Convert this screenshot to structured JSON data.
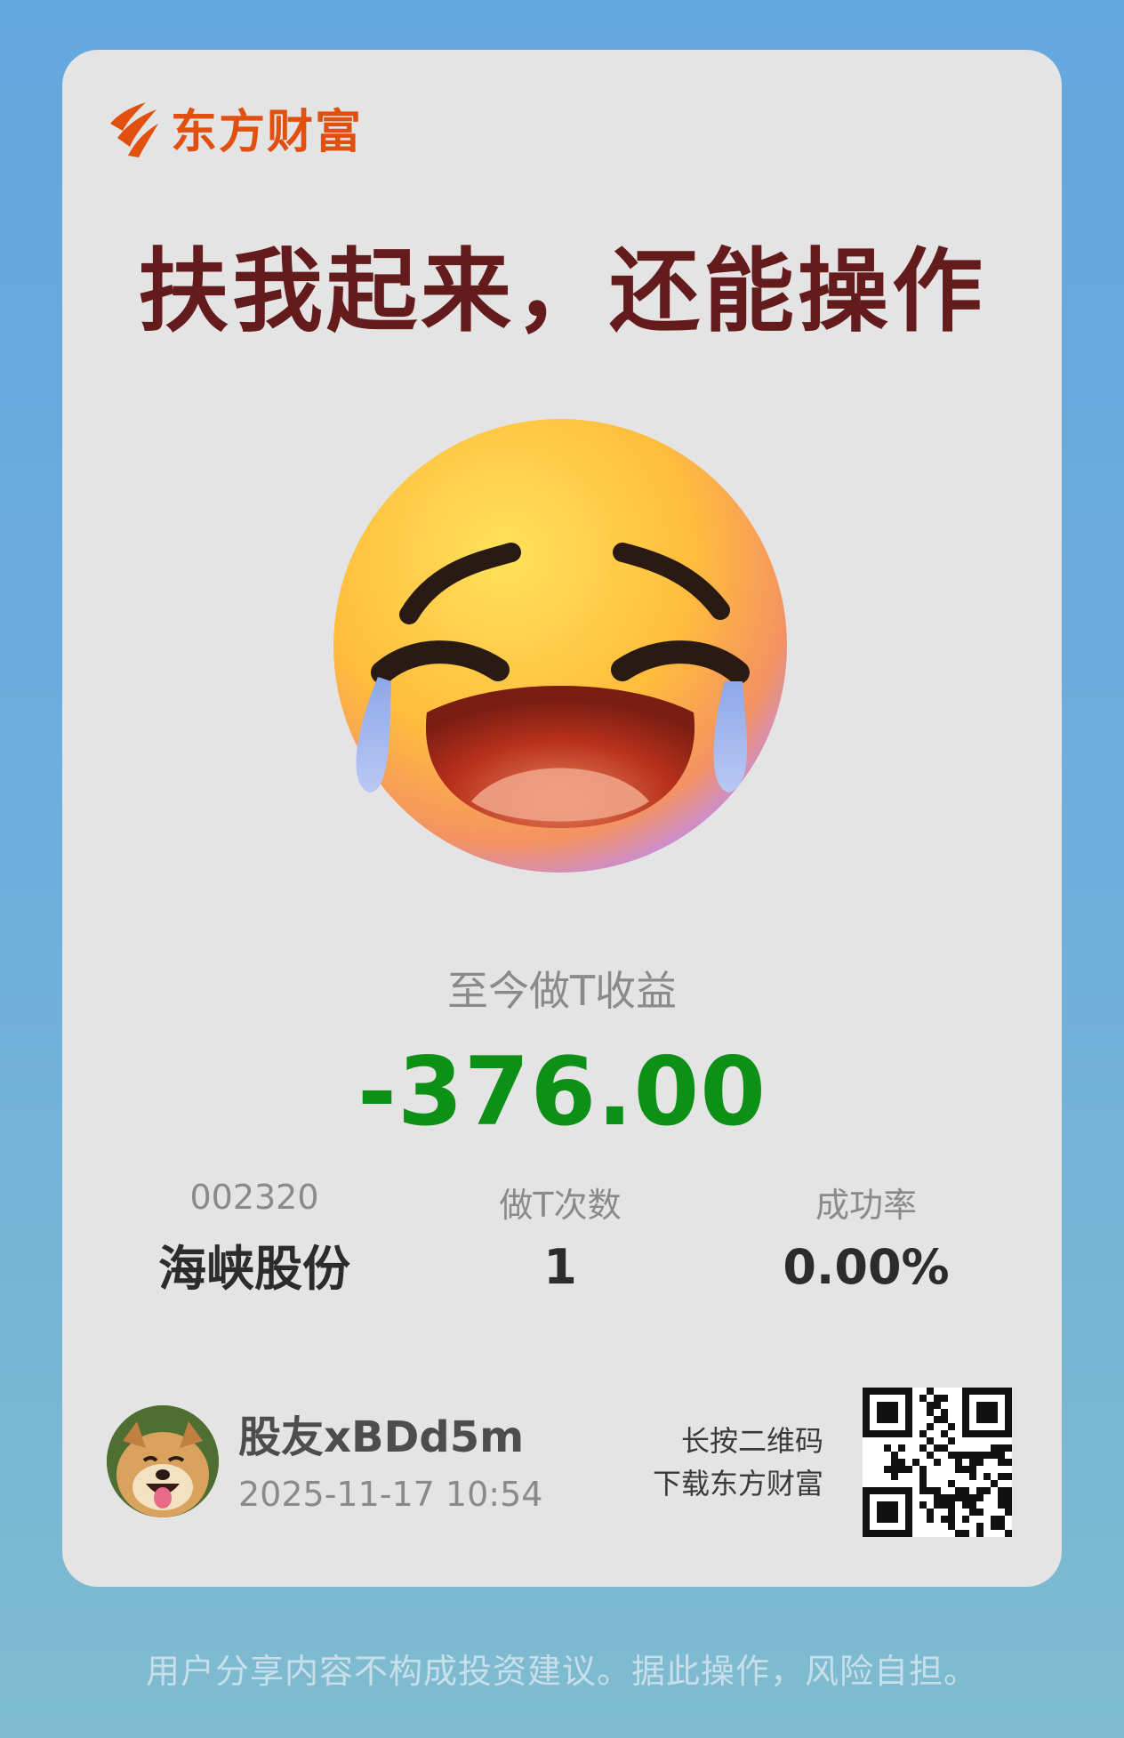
{
  "brand": {
    "name": "东方财富",
    "color": "#e1500f"
  },
  "headline": "扶我起来，还能操作",
  "emoji": "loudly-crying-face",
  "profit_label": "至今做T收益",
  "profit_value": "-376.00",
  "profit_color": "#0d9016",
  "stats": [
    {
      "key": "002320",
      "value": "海峡股份"
    },
    {
      "key": "做T次数",
      "value": "1"
    },
    {
      "key": "成功率",
      "value": "0.00%"
    }
  ],
  "user": {
    "name": "股友xBDd5m",
    "timestamp": "2025-11-17 10:54",
    "avatar": "shiba-dog-avatar"
  },
  "qr": {
    "line1": "长按二维码",
    "line2": "下载东方财富"
  },
  "disclaimer": "用户分享内容不构成投资建议。据此操作，风险自担。"
}
